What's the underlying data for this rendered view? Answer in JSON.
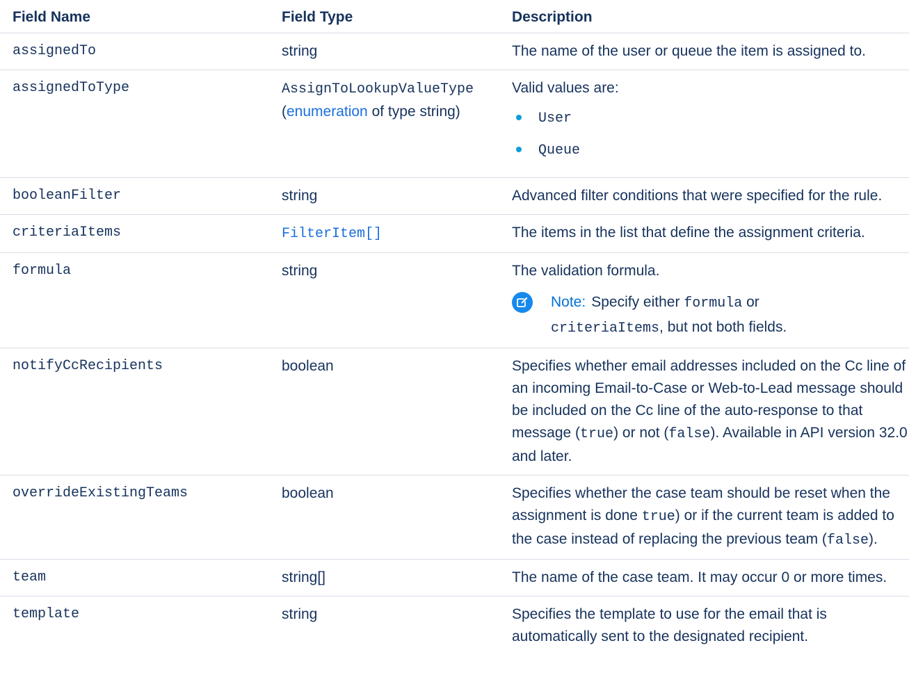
{
  "table": {
    "headers": {
      "field_name": "Field Name",
      "field_type": "Field Type",
      "description": "Description"
    },
    "rows": [
      {
        "name": "assignedTo",
        "type": "string",
        "description": "The name of the user or queue the item is assigned to."
      },
      {
        "name": "assignedToType",
        "type_code": "AssignToLookupValueType",
        "type_open": "(",
        "type_link": "enumeration",
        "type_rest": " of type string)",
        "description": "Valid values are:",
        "values": [
          "User",
          "Queue"
        ]
      },
      {
        "name": "booleanFilter",
        "type": "string",
        "description": "Advanced filter conditions that were specified for the rule."
      },
      {
        "name": "criteriaItems",
        "type_link": "FilterItem[]",
        "description": "The items in the list that define the assignment criteria."
      },
      {
        "name": "formula",
        "type": "string",
        "description": "The validation formula.",
        "note": {
          "label": "Note:",
          "text1": "Specify either ",
          "code1": "formula",
          "text2": " or",
          "code2": "criteriaItems",
          "text3": ", but not both fields."
        }
      },
      {
        "name": "notifyCcRecipients",
        "type": "boolean",
        "d1": "Specifies whether email addresses included on the Cc line of an incoming Email-to-Case or Web-to-Lead message should be included on the Cc line of the auto-response to that message (",
        "c1": "true",
        "d2": ") or not (",
        "c2": "false",
        "d3": "). Available in API version 32.0 and later."
      },
      {
        "name": "overrideExistingTeams",
        "type": "boolean",
        "d1": "Specifies whether the case team should be reset when the assignment is done ",
        "c1": "true",
        "d2": ") or if the current team is added to the case instead of replacing the previous team (",
        "c2": "false",
        "d3": ")."
      },
      {
        "name": "team",
        "type": "string[]",
        "description": "The name of the case team. It may occur 0 or more times."
      },
      {
        "name": "template",
        "type": "string",
        "description": "Specifies the template to use for the email that is automatically sent to the designated recipient."
      }
    ]
  },
  "colors": {
    "text": "#16325c",
    "link": "#1a6fde",
    "bullet": "#0d9dda",
    "note_icon": "#1589ee",
    "divider": "#d8dde6"
  }
}
